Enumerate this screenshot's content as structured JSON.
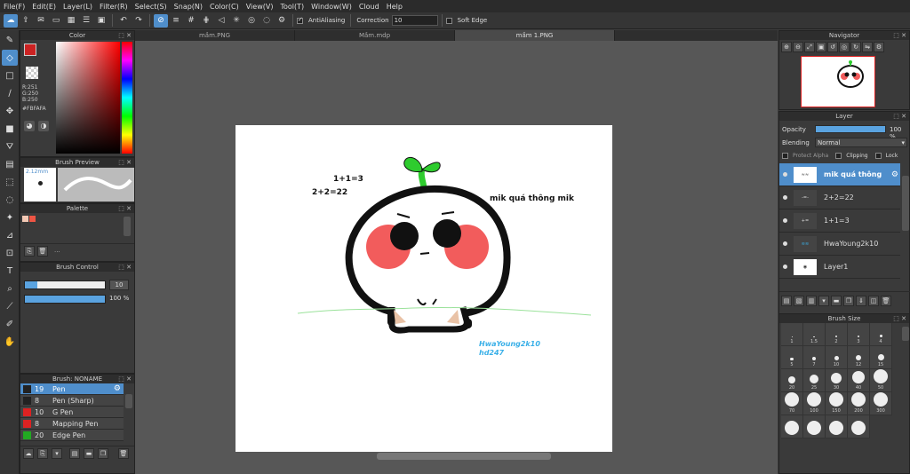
{
  "menu": [
    "File(F)",
    "Edit(E)",
    "Layer(L)",
    "Filter(R)",
    "Select(S)",
    "Snap(N)",
    "Color(C)",
    "View(V)",
    "Tool(T)",
    "Window(W)",
    "Cloud",
    "Help"
  ],
  "toolbar": {
    "antialiasing": "AntiAliasing",
    "correction_label": "Correction",
    "correction_value": "10",
    "soft_edge": "Soft Edge"
  },
  "tabs": [
    "mầm.PNG",
    "Mầm.mdp",
    "mầm 1.PNG"
  ],
  "color_panel": {
    "title": "Color",
    "r": "R:251",
    "g": "G:250",
    "b": "B:250",
    "hex": "#FBFAFA",
    "fg": "#cc2222",
    "bg": "#ffffff"
  },
  "brush_preview": {
    "title": "Brush Preview",
    "size": "2.12mm"
  },
  "palette": {
    "title": "Palette",
    "more": "..."
  },
  "brush_control": {
    "title": "Brush Control",
    "size": "10",
    "opacity": "100 %",
    "size_fraction": 0.15,
    "opacity_fraction": 1.0
  },
  "brush_list": {
    "title": "Brush: NONAME",
    "items": [
      {
        "num": "19",
        "name": "Pen",
        "color": "#222222",
        "sel": true
      },
      {
        "num": "8",
        "name": "Pen (Sharp)",
        "color": "#222222",
        "sel": false
      },
      {
        "num": "10",
        "name": "G Pen",
        "color": "#dd2222",
        "sel": false
      },
      {
        "num": "8",
        "name": "Mapping Pen",
        "color": "#dd2222",
        "sel": false
      },
      {
        "num": "20",
        "name": "Edge Pen",
        "color": "#22aa22",
        "sel": false
      }
    ]
  },
  "canvas_text": {
    "t1": "1+1=3",
    "t2": "2+2=22",
    "t3": "mik quá thông mik",
    "sig1": "HwaYoung2k10",
    "sig2": "hd247"
  },
  "navigator": {
    "title": "Navigator"
  },
  "layer_panel": {
    "title": "Layer",
    "opacity_label": "Opacity",
    "opacity_value": "100 %",
    "blending_label": "Blending",
    "blending_value": "Normal",
    "protect_alpha": "Protect Alpha",
    "clipping": "Clipping",
    "lock": "Lock",
    "layers": [
      {
        "name": "mik quá thông",
        "sel": true
      },
      {
        "name": "2+2=22",
        "sel": false
      },
      {
        "name": "1+1=3",
        "sel": false
      },
      {
        "name": "HwaYoung2k10",
        "sel": false
      },
      {
        "name": "Layer1",
        "sel": false
      }
    ]
  },
  "brush_size": {
    "title": "Brush Size",
    "sizes": [
      "1",
      "1.5",
      "2",
      "3",
      "4",
      "5",
      "7",
      "10",
      "12",
      "15",
      "20",
      "25",
      "30",
      "40",
      "50",
      "70",
      "100",
      "150",
      "200",
      "300",
      "",
      "",
      "",
      ""
    ]
  }
}
